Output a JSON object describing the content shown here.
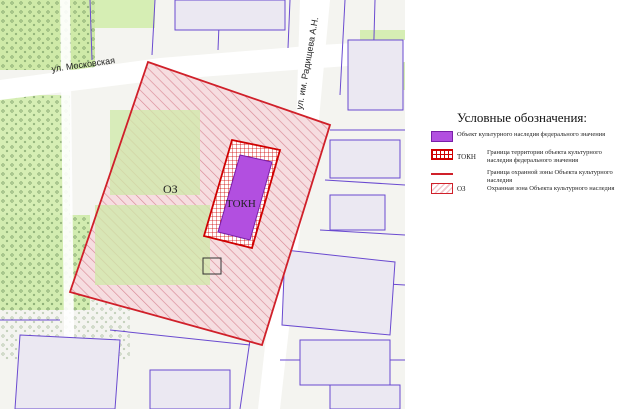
{
  "map": {
    "streets": {
      "moskovskaya": "ул. Московская",
      "radishcheva": "ул. им. Радищева А.Н."
    },
    "zone_label": "ОЗ",
    "object_label": "ТОКН"
  },
  "legend": {
    "title": "Условные обозначения:",
    "items": [
      {
        "swatch": "purple-fill",
        "code": "",
        "text": "Объект культурного наследия федерального значения"
      },
      {
        "swatch": "red-grid",
        "code": "ТОКН",
        "text": "Граница территории объекта культурного наследия федерального значения"
      },
      {
        "swatch": "red-line",
        "code": "",
        "text": "Граница охранной зоны Объекта культурного наследия"
      },
      {
        "swatch": "red-hatch",
        "code": "ОЗ",
        "text": "Охранная зона Объекта культурного наследия"
      }
    ]
  },
  "colors": {
    "zone_border": "#d0202a",
    "object_fill": "#b24fe0",
    "parcel_lines": "#6a4ad0",
    "green_areas": "#cfeaa8",
    "hatch": "#e8a9b3"
  }
}
